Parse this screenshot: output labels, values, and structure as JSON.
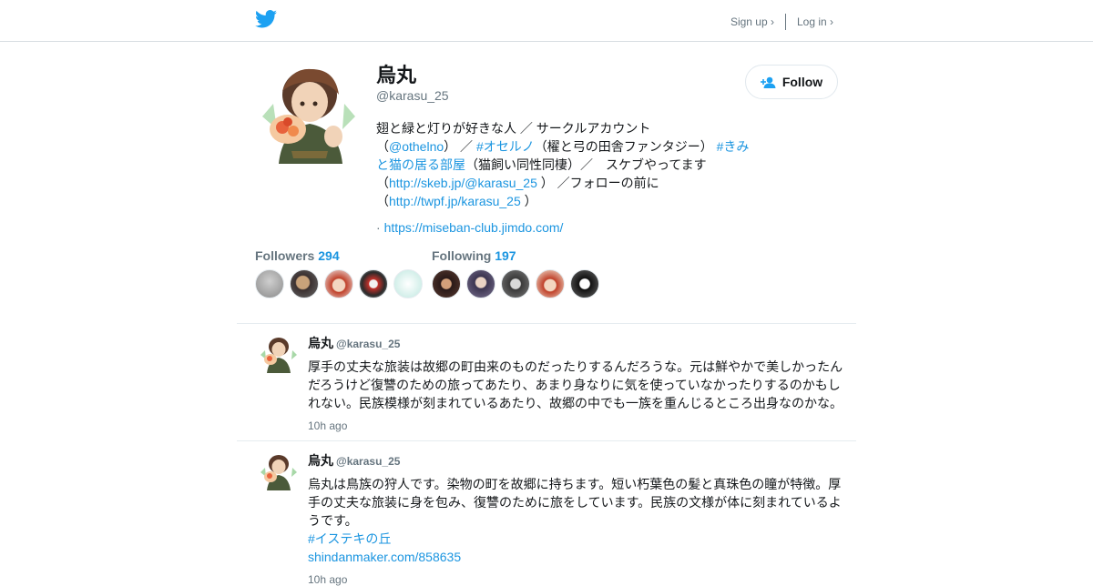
{
  "header": {
    "logo_icon": "twitter-bird-icon",
    "signup_label": "Sign up ›",
    "login_label": "Log in ›"
  },
  "profile": {
    "name": "烏丸",
    "handle": "@karasu_25",
    "follow_label": "Follow",
    "bio": {
      "t1": "翅と緑と灯りが好きな人 ／ サークルアカウント",
      "t2": "（",
      "mention": "@othelno",
      "t3": "） ／ ",
      "hashtag1": "#オセルノ",
      "t4": "（櫂と弓の田舎ファンタジー） ",
      "hashtag2": "#きみと猫の居る部屋",
      "t5": "（猫飼い同性同棲）／　スケブやってます",
      "t6": "（",
      "link1": "http://skeb.jp/@karasu_25",
      "t7": " ） ／フォローの前に",
      "t8": "（",
      "link2": "http://twpf.jp/karasu_25",
      "t9": " ）"
    },
    "website_prefix": "· ",
    "website": "https://miseban-club.jimdo.com/"
  },
  "followers": {
    "label": "Followers",
    "count": "294"
  },
  "following": {
    "label": "Following",
    "count": "197"
  },
  "tweets": [
    {
      "name": "烏丸",
      "handle": "@karasu_25",
      "text": "厚手の丈夫な旅装は故郷の町由来のものだったりするんだろうな。元は鮮やかで美しかったんだろうけど復讐のための旅ってあたり、あまり身なりに気を使っていなかったりするのかもしれない。民族模様が刻まれているあたり、故郷の中でも一族を重んじるところ出身なのかな。",
      "time": "10h ago"
    },
    {
      "name": "烏丸",
      "handle": "@karasu_25",
      "text": "烏丸は鳥族の狩人です。染物の町を故郷に持ちます。短い朽葉色の髪と真珠色の瞳が特徴。厚手の丈夫な旅装に身を包み、復讐のために旅をしています。民族の文様が体に刻まれているようです。",
      "hashtag": "#イステキの丘",
      "link": "shindanmaker.com/858635",
      "time": "10h ago"
    }
  ]
}
